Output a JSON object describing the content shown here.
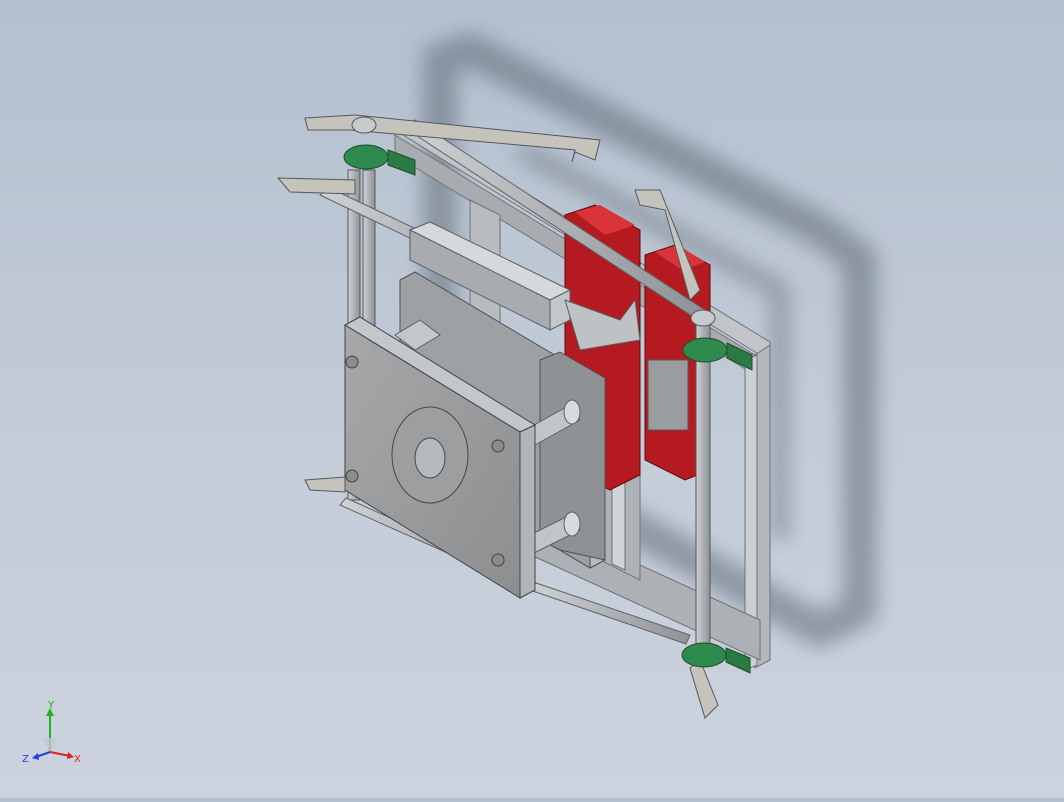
{
  "viewport": {
    "background_top": "#b4c0cf",
    "background_bottom": "#ccd3de"
  },
  "model": {
    "frame_color": "#b8bcc0",
    "plate_color": "#9a9c9e",
    "bearing_color": "#2f8a4d",
    "cylinder_color": "#c91f25",
    "shadow_color": "#6f7a86"
  },
  "triad": {
    "x_label": "X",
    "y_label": "Y",
    "z_label": "Z",
    "x_color": "#e02020",
    "y_color": "#20b020",
    "z_color": "#2040e0"
  }
}
